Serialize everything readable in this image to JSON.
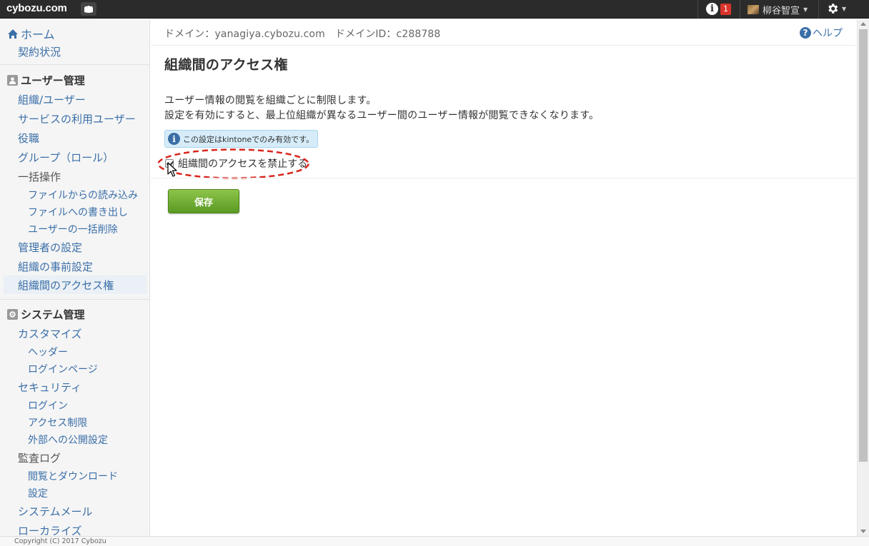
{
  "topbar": {
    "logo": "cybozu.com",
    "notification_count": "1",
    "user_name": "柳谷智宣"
  },
  "sidebar": {
    "home": "ホーム",
    "contract": "契約状況",
    "user_mgmt_heading": "ユーザー管理",
    "user_items": {
      "org_users": "組織/ユーザー",
      "service_users": "サービスの利用ユーザー",
      "roles": "役職",
      "groups": "グループ（ロール）",
      "bulk": "一括操作",
      "import": "ファイルからの読み込み",
      "export": "ファイルへの書き出し",
      "bulk_delete": "ユーザーの一括削除",
      "admin_settings": "管理者の設定",
      "org_presettings": "組織の事前設定",
      "inter_org_access": "組織間のアクセス権"
    },
    "system_mgmt_heading": "システム管理",
    "system_items": {
      "customize": "カスタマイズ",
      "header": "ヘッダー",
      "login_page": "ログインページ",
      "security": "セキュリティ",
      "login": "ログイン",
      "access_restriction": "アクセス制限",
      "external_publish": "外部への公開設定",
      "audit_log": "監査ログ",
      "view_download": "閲覧とダウンロード",
      "settings": "設定",
      "system_mail": "システムメール",
      "localize": "ローカライズ"
    }
  },
  "main": {
    "domain_info": "ドメイン：yanagiya.cybozu.com　ドメインID：c288788",
    "help": "ヘルプ",
    "title": "組織間のアクセス権",
    "desc_line1": "ユーザー情報の閲覧を組織ごとに制限します。",
    "desc_line2": "設定を有効にすると、最上位組織が異なるユーザー間のユーザー情報が閲覧できなくなります。",
    "info_note": "この設定はkintoneでのみ有効です。",
    "checkbox_label": "組織間のアクセスを禁止する",
    "checkbox_checked": true,
    "save_button": "保存"
  },
  "footer": {
    "copyright": "Copyright (C) 2017 Cybozu"
  },
  "colors": {
    "link": "#3b6fa8",
    "active_indicator": "#51c0e8",
    "save_button": "#6aab2e",
    "badge": "#d9342b",
    "annotation": "#d9251d"
  }
}
